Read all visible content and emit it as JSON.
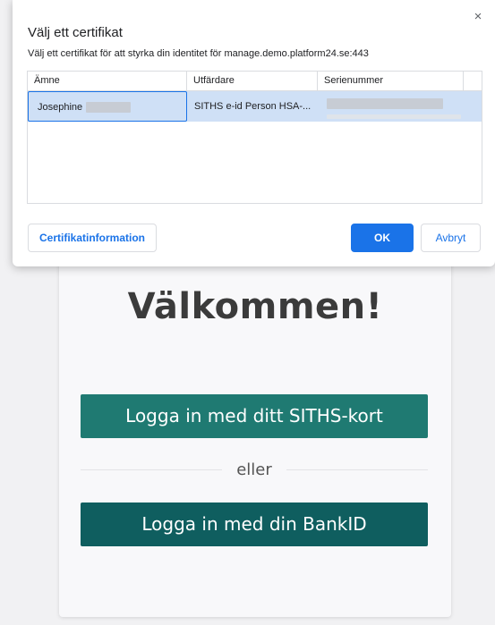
{
  "page": {
    "welcome_heading": "Välkommen!",
    "siths_button_label": "Logga in med ditt SITHS-kort",
    "divider_text": "eller",
    "bankid_button_label": "Logga in med din BankID"
  },
  "dialog": {
    "title": "Välj ett certifikat",
    "close_icon": "×",
    "subtitle": "Välj ett certifikat för att styrka din identitet för manage.demo.platform24.se:443",
    "columns": [
      "Ämne",
      "Utfärdare",
      "Serienummer"
    ],
    "rows": [
      {
        "subject": "Josephine",
        "issuer": "SITHS e-id Person HSA-...",
        "serial": ""
      }
    ],
    "buttons": {
      "info": "Certifikatinformation",
      "ok": "OK",
      "cancel": "Avbryt"
    }
  },
  "colors": {
    "accent": "#1a73e8",
    "siths_button": "#1f7a72",
    "bankid_button": "#0f5e5f",
    "selected_row": "#cfe0f6"
  }
}
